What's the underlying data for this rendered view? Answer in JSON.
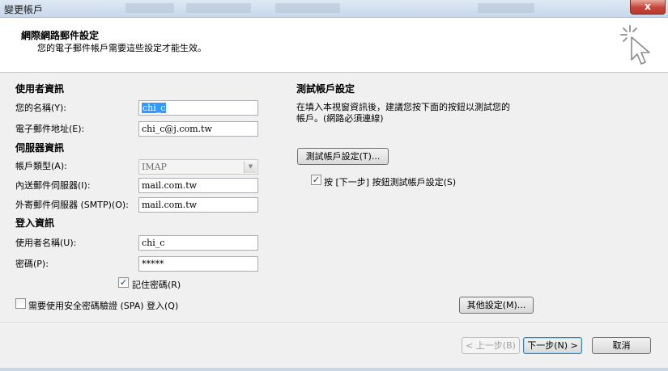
{
  "window": {
    "title": "變更帳戶",
    "close_label": "x"
  },
  "header": {
    "title": "網際網路郵件設定",
    "subtitle": "您的電子郵件帳戶需要這些設定才能生效。"
  },
  "user_info": {
    "heading": "使用者資訊",
    "name_label": "您的名稱(Y):",
    "name_value": "chi_c",
    "email_label": "電子郵件地址(E):",
    "email_value": "chi_c@j.com.tw"
  },
  "server_info": {
    "heading": "伺服器資訊",
    "type_label": "帳戶類型(A):",
    "type_value": "IMAP",
    "incoming_label": "內送郵件伺服器(I):",
    "incoming_value": "mail.com.tw",
    "outgoing_label": "外寄郵件伺服器 (SMTP)(O):",
    "outgoing_value": "mail.com.tw"
  },
  "login_info": {
    "heading": "登入資訊",
    "username_label": "使用者名稱(U):",
    "username_value": "chi_c",
    "password_label": "密碼(P):",
    "password_value": "*****",
    "remember_label": "記住密碼(R)",
    "remember_checked": "✓",
    "spa_label": "需要使用安全密碼驗證 (SPA) 登入(Q)"
  },
  "test": {
    "heading": "測試帳戶設定",
    "description_line1": "在填入本視窗資訊後，建議您按下面的按鈕以測試您的",
    "description_line2": "帳戶。(網路必須連線)",
    "test_button": "測試帳戶設定(T)...",
    "auto_test_label": "按 [下一步] 按鈕測試帳戶設定(S)",
    "auto_test_checked": "✓"
  },
  "buttons": {
    "more_settings": "其他設定(M)...",
    "back": "< 上一步(B)",
    "next": "下一步(N) >",
    "cancel": "取消"
  }
}
